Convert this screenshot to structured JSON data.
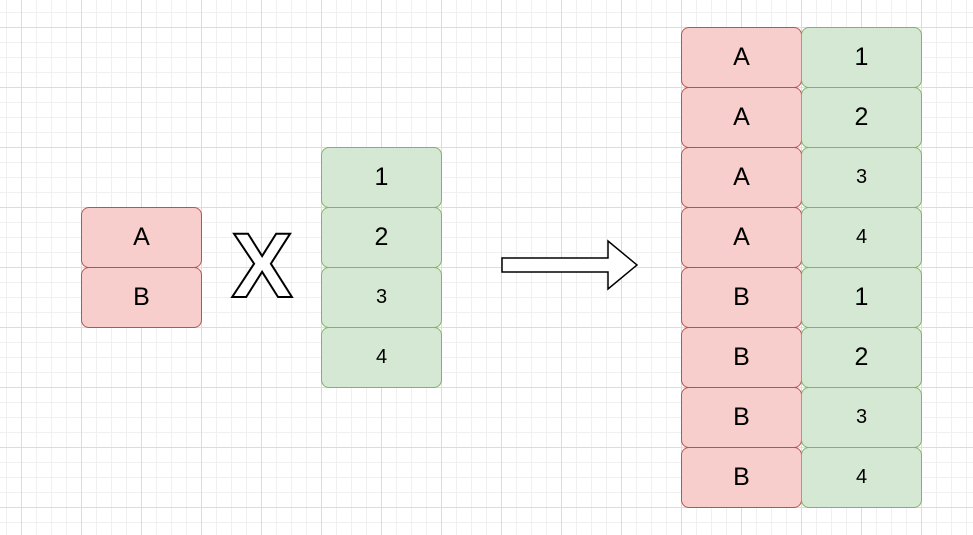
{
  "left_set": [
    "A",
    "B"
  ],
  "right_set": [
    "1",
    "2",
    "3",
    "4"
  ],
  "operator": "X",
  "result": [
    {
      "letter": "A",
      "number": "1"
    },
    {
      "letter": "A",
      "number": "2"
    },
    {
      "letter": "A",
      "number": "3"
    },
    {
      "letter": "A",
      "number": "4"
    },
    {
      "letter": "B",
      "number": "1"
    },
    {
      "letter": "B",
      "number": "2"
    },
    {
      "letter": "B",
      "number": "3"
    },
    {
      "letter": "B",
      "number": "4"
    }
  ],
  "colors": {
    "red_fill": "#f8cecc",
    "red_stroke": "#b85450",
    "green_fill": "#d5e8d4",
    "green_stroke": "#82b366"
  }
}
